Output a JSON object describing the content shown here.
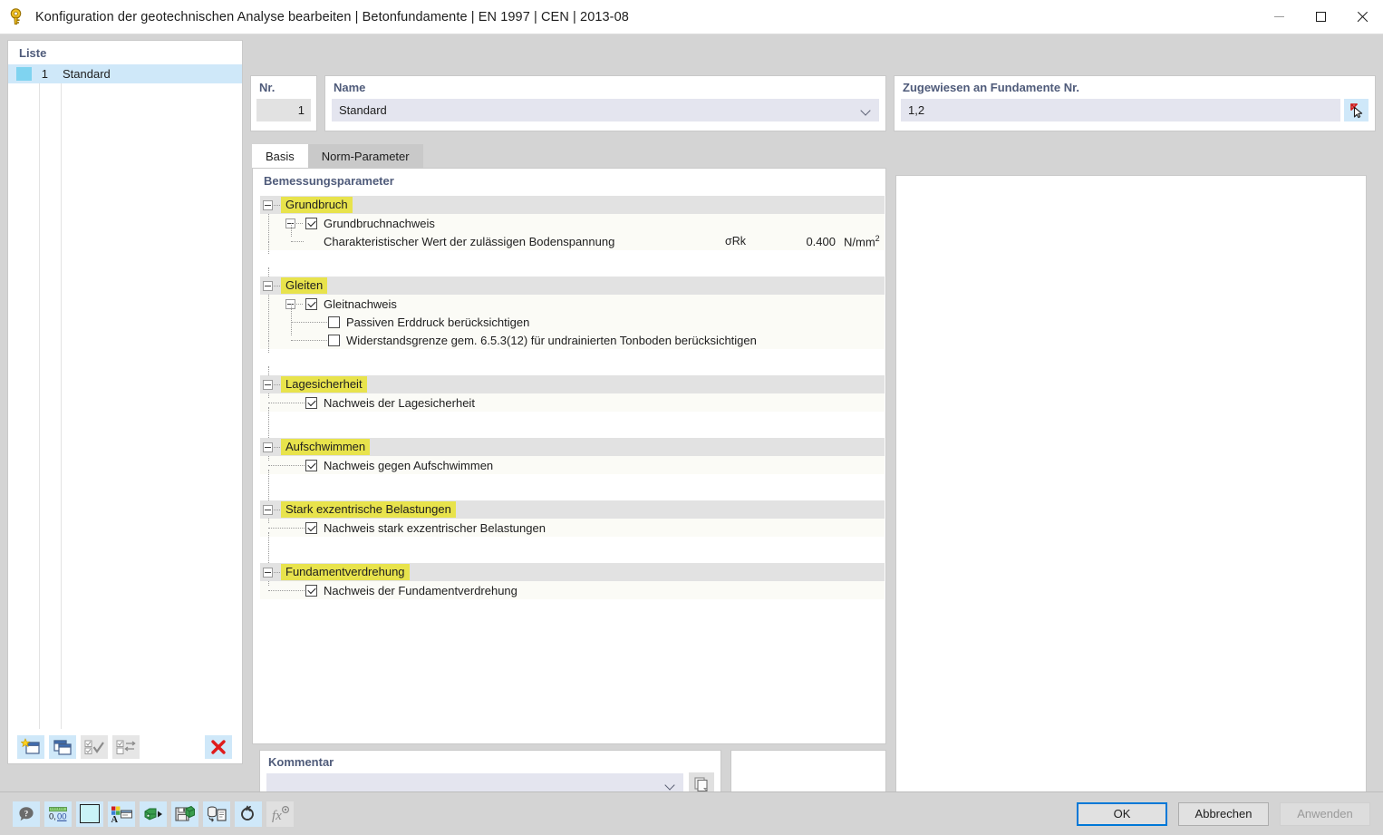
{
  "window": {
    "title": "Konfiguration der geotechnischen Analyse bearbeiten | Betonfundamente | EN 1997 | CEN | 2013-08",
    "app_icon": "lock-key-icon",
    "minimize_label": "Minimieren",
    "maximize_label": "Maximieren",
    "close_label": "Schließen"
  },
  "list_panel": {
    "caption": "Liste",
    "rows": [
      {
        "color": "#7fd3f0",
        "no": "1",
        "name": "Standard",
        "selected": true
      }
    ],
    "toolbar": [
      {
        "name": "new-item-button",
        "title": "Neu",
        "enabled": true
      },
      {
        "name": "duplicate-item-button",
        "title": "Duplizieren",
        "enabled": true
      },
      {
        "name": "select-all-button",
        "title": "Alle auswählen",
        "enabled": false
      },
      {
        "name": "invert-selection-button",
        "title": "Auswahl umkehren",
        "enabled": false
      },
      {
        "name": "delete-item-button",
        "title": "Löschen",
        "enabled": true
      }
    ]
  },
  "fields": {
    "nr_label": "Nr.",
    "nr_value": "1",
    "name_label": "Name",
    "name_value": "Standard",
    "assigned_label": "Zugewiesen an Fundamente Nr.",
    "assigned_value": "1,2",
    "pick_button_title": "Auswählen"
  },
  "tabs": [
    {
      "label": "Basis",
      "active": true
    },
    {
      "label": "Norm-Parameter",
      "active": false
    }
  ],
  "params": {
    "caption": "Bemessungsparameter",
    "groups": [
      {
        "title": "Grundbruch",
        "rows": [
          {
            "kind": "check",
            "label": "Grundbruchnachweis",
            "checked": true,
            "expander": true,
            "symbol": "",
            "value": "",
            "unit": ""
          },
          {
            "kind": "leaf",
            "label": "Charakteristischer Wert der zulässigen Bodenspannung",
            "symbol": "σRk",
            "value": "0.400",
            "unit": "N/mm",
            "unit_sup": "2"
          }
        ]
      },
      {
        "title": "Gleiten",
        "rows": [
          {
            "kind": "check",
            "label": "Gleitnachweis",
            "checked": true,
            "expander": true,
            "symbol": "",
            "value": "",
            "unit": ""
          },
          {
            "kind": "check-sub",
            "label": "Passiven Erddruck berücksichtigen",
            "checked": false,
            "symbol": "",
            "value": "",
            "unit": ""
          },
          {
            "kind": "check-sub",
            "label": "Widerstandsgrenze gem. 6.5.3(12) für undrainierten Tonboden berücksichtigen",
            "checked": false,
            "symbol": "",
            "value": "",
            "unit": ""
          }
        ]
      },
      {
        "title": "Lagesicherheit",
        "rows": [
          {
            "kind": "check-nosub",
            "label": "Nachweis der Lagesicherheit",
            "checked": true,
            "symbol": "",
            "value": "",
            "unit": ""
          }
        ]
      },
      {
        "title": "Aufschwimmen",
        "rows": [
          {
            "kind": "check-nosub",
            "label": "Nachweis gegen Aufschwimmen",
            "checked": true,
            "symbol": "",
            "value": "",
            "unit": ""
          }
        ]
      },
      {
        "title": "Stark exzentrische Belastungen",
        "rows": [
          {
            "kind": "check-nosub",
            "label": "Nachweis stark exzentrischer Belastungen",
            "checked": true,
            "symbol": "",
            "value": "",
            "unit": ""
          }
        ]
      },
      {
        "title": "Fundamentverdrehung",
        "rows": [
          {
            "kind": "check-nosub",
            "label": "Nachweis der Fundamentverdrehung",
            "checked": true,
            "symbol": "",
            "value": "",
            "unit": ""
          }
        ]
      }
    ]
  },
  "comment": {
    "label": "Kommentar",
    "value": "",
    "copy_button_title": "Kopieren"
  },
  "bottom_toolbar": [
    {
      "name": "help-button",
      "title": "Hilfe",
      "enabled": true
    },
    {
      "name": "units-button",
      "title": "Einheiten und Dezimalstellen",
      "enabled": true
    },
    {
      "name": "color-swatch-button",
      "title": "Farbe",
      "enabled": true
    },
    {
      "name": "graphics-button",
      "title": "Grafik-Einstellungen",
      "enabled": true
    },
    {
      "name": "import-button",
      "title": "Importieren",
      "enabled": true
    },
    {
      "name": "save-button",
      "title": "Speichern",
      "enabled": true
    },
    {
      "name": "database-button",
      "title": "Datenbank",
      "enabled": true
    },
    {
      "name": "reset-button",
      "title": "Zurücksetzen",
      "enabled": true
    },
    {
      "name": "formula-button",
      "title": "Formel",
      "enabled": false
    }
  ],
  "dialog_buttons": [
    {
      "name": "ok-button",
      "label": "OK",
      "enabled": true,
      "primary": true
    },
    {
      "name": "cancel-button",
      "label": "Abbrechen",
      "enabled": true,
      "primary": false
    },
    {
      "name": "apply-button",
      "label": "Anwenden",
      "enabled": false,
      "primary": false
    }
  ],
  "colors": {
    "accent": "#0078d7",
    "highlight_yellow": "#e8e34c",
    "selection_blue": "#cfe8f9",
    "field_lilac": "#e4e5ef",
    "caption_blue": "#4f5b7a",
    "delete_red": "#e01b1b"
  }
}
